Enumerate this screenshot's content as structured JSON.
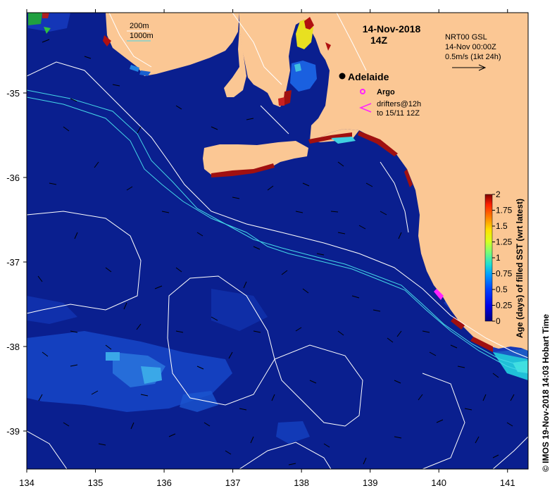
{
  "map": {
    "date_line1": "14-Nov-2018",
    "date_line2": "14Z",
    "depth_contour_200": "200m",
    "depth_contour_1000": "1000m",
    "city_label": "Adelaide",
    "argo_label": "Argo",
    "drifters_line1": "drifters@12h",
    "drifters_line2": "to 15/11 12Z",
    "velocity_line1": "NRT00 GSL",
    "velocity_line2": "14-Nov 00:00Z",
    "velocity_line3": "0.5m/s (1kt 24h)",
    "copyright": "©  IMOS 19-Nov-2018 14:03 Hobart Time",
    "colorbar_title": "Age (days) of filled SST (wrt latest)",
    "colors": {
      "ocean": "#0a1f8f",
      "land": "#fbc794",
      "contour": "#ffffff",
      "contour_1000": "#45d7e8",
      "argo": "#ff22ff",
      "drifter": "#ff22ff"
    }
  },
  "axes": {
    "x_ticks": [
      "134",
      "135",
      "136",
      "137",
      "138",
      "139",
      "140",
      "141"
    ],
    "y_ticks": [
      "-35",
      "-36",
      "-37",
      "-38",
      "-39"
    ],
    "x_range": [
      134,
      141.3
    ],
    "y_range": [
      -39.45,
      -34.05
    ]
  },
  "colorbar": {
    "ticks": [
      "2",
      "1.75",
      "1.5",
      "1.25",
      "1",
      "0.75",
      "0.5",
      "0.25",
      "0"
    ],
    "range": [
      0,
      2
    ]
  }
}
